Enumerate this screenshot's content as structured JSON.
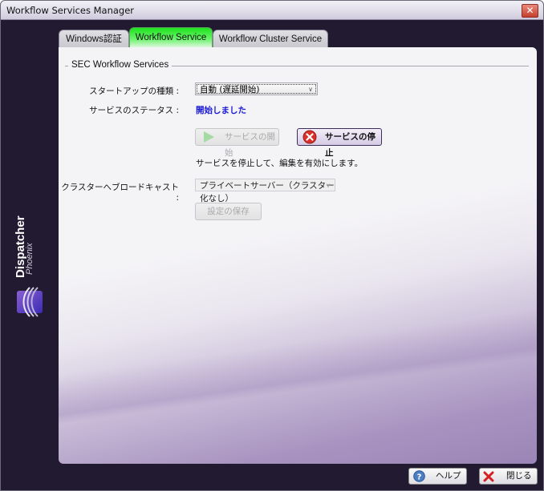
{
  "window": {
    "title": "Workflow Services Manager",
    "close_glyph": "✕"
  },
  "brand": {
    "name": "Dispatcher",
    "sub": "Phoenix",
    "logo_icon": "dispatcher-logo-icon"
  },
  "tabs": [
    {
      "label": "Windows認証",
      "active": false
    },
    {
      "label": "Workflow Service",
      "active": true
    },
    {
      "label": "Workflow Cluster Service",
      "active": false
    }
  ],
  "group": {
    "title": "SEC Workflow Services"
  },
  "form": {
    "startup_type_label": "スタートアップの種類 :",
    "startup_type_value": "自動 (遅延開始)",
    "service_status_label": "サービスのステータス :",
    "service_status_value": "開始しました",
    "start_button_label": "サービスの開始",
    "stop_button_label": "サービスの停止",
    "hint_text": "サービスを停止して、編集を有効にします。",
    "cluster_broadcast_label": "クラスターへブロードキャスト :",
    "cluster_broadcast_value": "プライベートサーバー（クラスター化なし）",
    "save_button_label": "設定の保存"
  },
  "footer": {
    "help_label": "ヘルプ",
    "close_label": "閉じる"
  },
  "colors": {
    "status_value": "#1a1ad6",
    "active_tab": "#1de21d",
    "background": "#211a31"
  }
}
